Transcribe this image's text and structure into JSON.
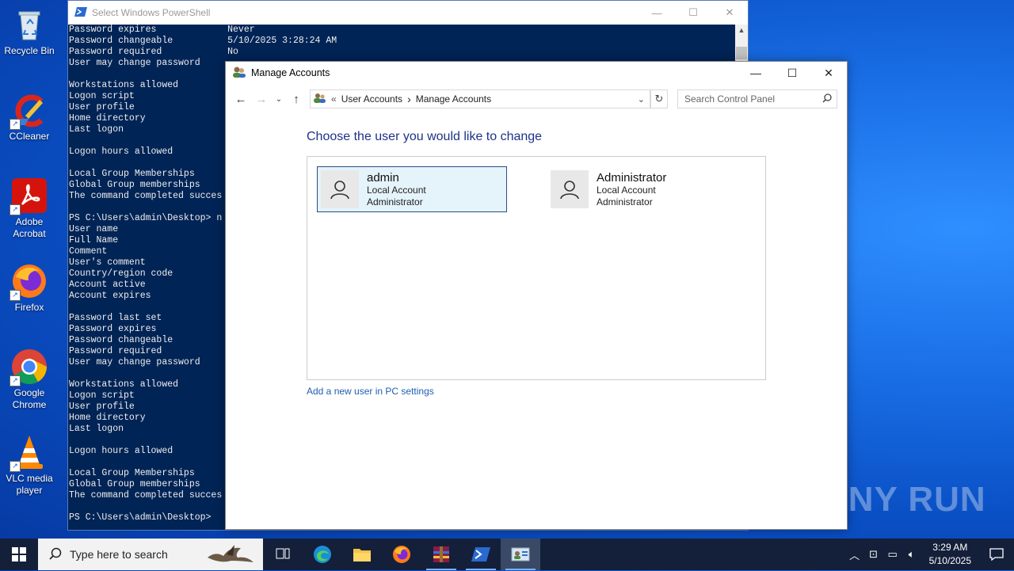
{
  "desktop_icons": [
    {
      "label": "Recycle Bin",
      "icon": "recycle-bin-icon"
    },
    {
      "label": "CCleaner",
      "icon": "ccleaner-icon"
    },
    {
      "label": "Adobe Acrobat",
      "icon": "acrobat-icon"
    },
    {
      "label": "Firefox",
      "icon": "firefox-icon"
    },
    {
      "label": "Google Chrome",
      "icon": "chrome-icon"
    },
    {
      "label": "VLC media player",
      "icon": "vlc-icon"
    }
  ],
  "powershell": {
    "title": "Select Windows PowerShell",
    "lines": [
      "Password expires             Never",
      "Password changeable          5/10/2025 3:28:24 AM",
      "Password required            No",
      "User may change password",
      "",
      "Workstations allowed",
      "Logon script",
      "User profile",
      "Home directory",
      "Last logon",
      "",
      "Logon hours allowed",
      "",
      "Local Group Memberships",
      "Global Group memberships",
      "The command completed succes",
      "",
      "PS C:\\Users\\admin\\Desktop> n",
      "User name",
      "Full Name",
      "Comment",
      "User's comment",
      "Country/region code",
      "Account active",
      "Account expires",
      "",
      "Password last set",
      "Password expires",
      "Password changeable",
      "Password required",
      "User may change password",
      "",
      "Workstations allowed",
      "Logon script",
      "User profile",
      "Home directory",
      "Last logon",
      "",
      "Logon hours allowed",
      "",
      "Local Group Memberships",
      "Global Group memberships",
      "The command completed succes",
      "",
      "PS C:\\Users\\admin\\Desktop>"
    ]
  },
  "manage_accounts": {
    "title": "Manage Accounts",
    "breadcrumb": [
      "«",
      "User Accounts",
      "›",
      "Manage Accounts"
    ],
    "search_placeholder": "Search Control Panel",
    "heading": "Choose the user you would like to change",
    "accounts": [
      {
        "name": "admin",
        "type": "Local Account",
        "role": "Administrator",
        "selected": true
      },
      {
        "name": "Administrator",
        "type": "Local Account",
        "role": "Administrator",
        "selected": false
      }
    ],
    "add_link": "Add a new user in PC settings"
  },
  "watermark": "ANY RUN",
  "taskbar": {
    "search_placeholder": "Type here to search",
    "apps": [
      "task-view-icon",
      "edge-icon",
      "file-explorer-icon",
      "firefox-icon",
      "winrar-icon",
      "powershell-icon",
      "control-panel-icon"
    ],
    "time": "3:29 AM",
    "date": "5/10/2025"
  }
}
